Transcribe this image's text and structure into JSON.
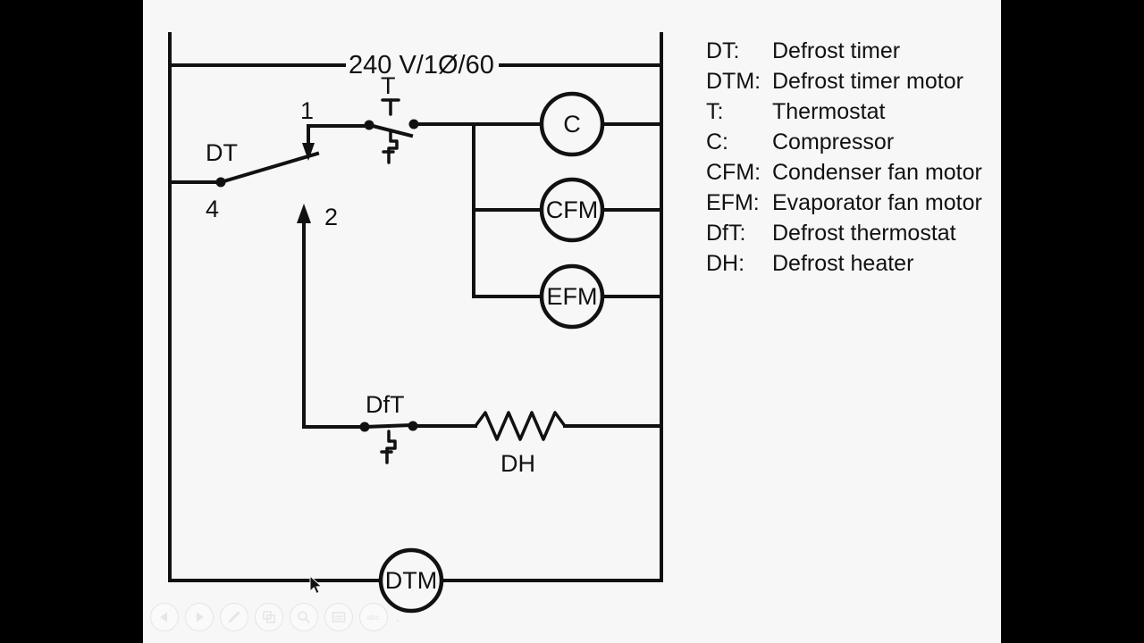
{
  "slide": {
    "supply_label": "240 V/1Ø/60",
    "terminals": {
      "one": "1",
      "two": "2",
      "four": "4"
    },
    "components": {
      "defrost_timer": "DT",
      "thermostat": "T",
      "compressor": "C",
      "condenser_fan_motor": "CFM",
      "evaporator_fan_motor": "EFM",
      "defrost_thermostat": "DfT",
      "defrost_heater": "DH",
      "defrost_timer_motor": "DTM"
    }
  },
  "legend": {
    "items": [
      {
        "abbr": "DT:",
        "desc": "Defrost timer"
      },
      {
        "abbr": "DTM:",
        "desc": "Defrost timer motor"
      },
      {
        "abbr": "T:",
        "desc": "Thermostat"
      },
      {
        "abbr": "C:",
        "desc": "Compressor"
      },
      {
        "abbr": "CFM:",
        "desc": "Condenser fan motor"
      },
      {
        "abbr": "EFM:",
        "desc": "Evaporator fan motor"
      },
      {
        "abbr": "DfT:",
        "desc": "Defrost thermostat"
      },
      {
        "abbr": "DH:",
        "desc": "Defrost heater"
      }
    ]
  },
  "toolbar": {
    "buttons": [
      {
        "name": "previous-icon",
        "label": "Previous"
      },
      {
        "name": "play-icon",
        "label": "Play"
      },
      {
        "name": "pen-icon",
        "label": "Pen"
      },
      {
        "name": "duplicate-icon",
        "label": "Duplicate"
      },
      {
        "name": "magnifier-icon",
        "label": "Zoom"
      },
      {
        "name": "notes-icon",
        "label": "Notes"
      },
      {
        "name": "abc-icon",
        "label": "abc"
      }
    ],
    "abc_label": "abc",
    "trailing_dot": "."
  },
  "colors": {
    "background": "#000000",
    "slide_background": "#f7f7f7",
    "ink": "#111111",
    "toolbar_outline": "#e2e2e2"
  }
}
